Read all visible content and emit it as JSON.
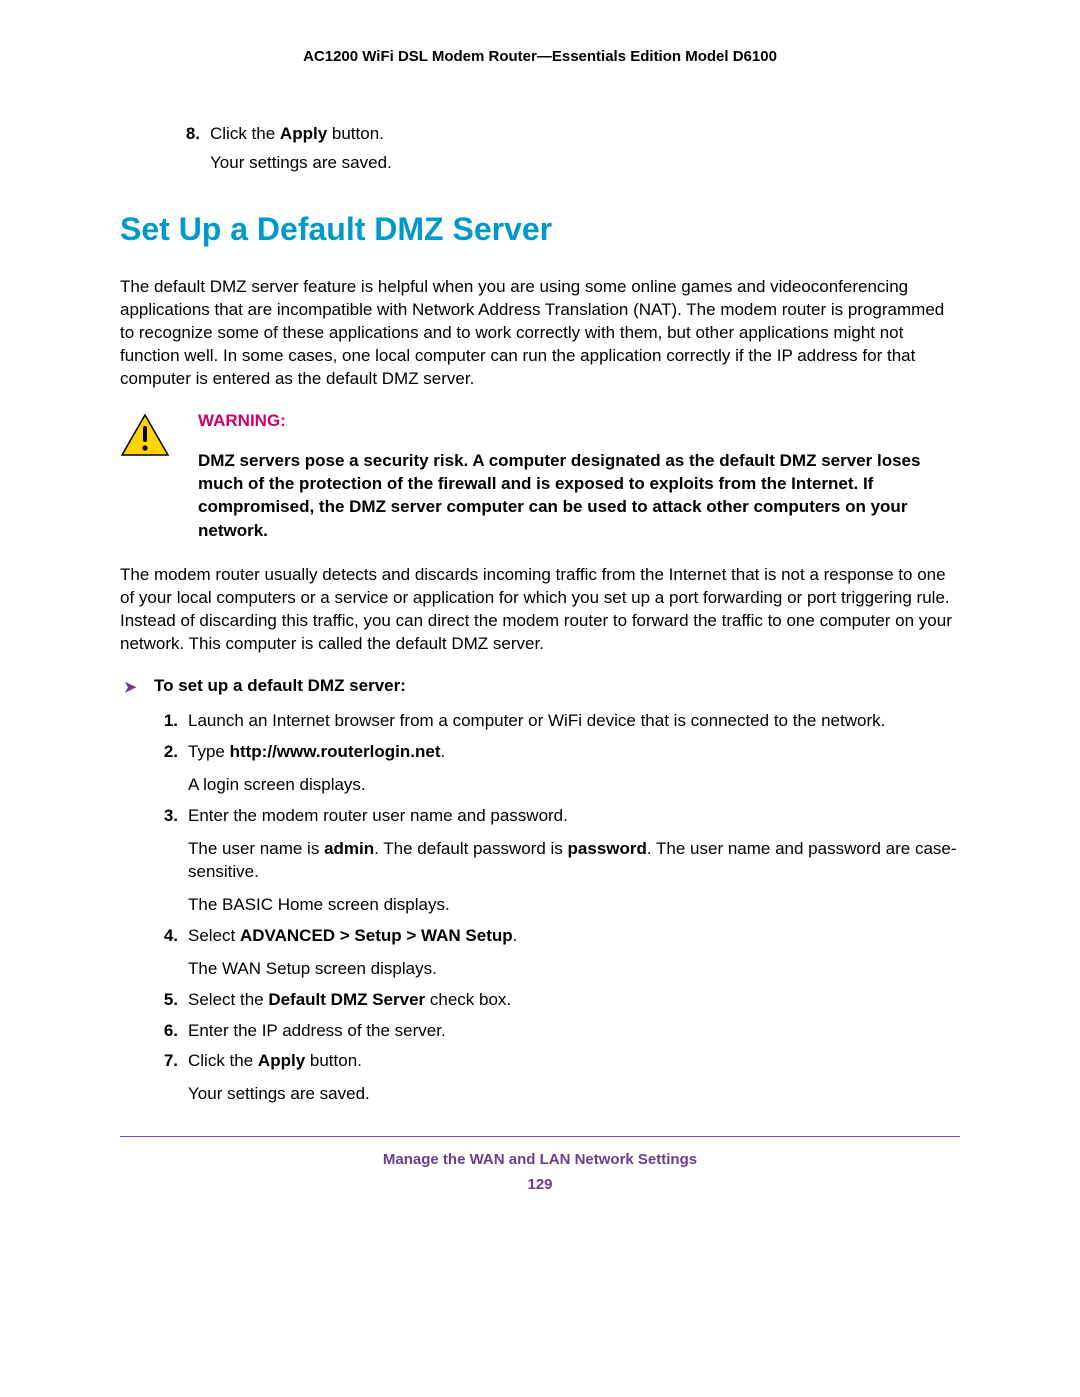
{
  "header": {
    "title": "AC1200 WiFi DSL Modem Router—Essentials Edition Model D6100"
  },
  "prior_steps": {
    "num8": "8.",
    "line8_pre": "Click the ",
    "line8_bold": "Apply",
    "line8_post": " button.",
    "line8_sub": "Your settings are saved."
  },
  "section_heading": "Set Up a Default DMZ Server",
  "para1": "The default DMZ server feature is helpful when you are using some online games and videoconferencing applications that are incompatible with Network Address Translation (NAT). The modem router is programmed to recognize some of these applications and to work correctly with them, but other applications might not function well. In some cases, one local computer can run the application correctly if the IP address for that computer is entered as the default DMZ server.",
  "warning": {
    "label": "WARNING:",
    "text": "DMZ servers pose a security risk. A computer designated as the default DMZ server loses much of the protection of the firewall and is exposed to exploits from the Internet. If compromised, the DMZ server computer can be used to attack other computers on your network."
  },
  "para2": "The modem router usually detects and discards incoming traffic from the Internet that is not a response to one of your local computers or a service or application for which you set up a port forwarding or port triggering rule. Instead of discarding this traffic, you can direct the modem router to forward the traffic to one computer on your network. This computer is called the default DMZ server.",
  "procedure_intro": "To set up a default DMZ server:",
  "steps": {
    "n1": "1.",
    "s1": "Launch an Internet browser from a computer or WiFi device that is connected to the network.",
    "n2": "2.",
    "s2_pre": "Type ",
    "s2_bold": "http://www.routerlogin.net",
    "s2_post": ".",
    "s2_sub": "A login screen displays.",
    "n3": "3.",
    "s3": "Enter the modem router user name and password.",
    "s3_sub_a": "The user name is ",
    "s3_sub_b": "admin",
    "s3_sub_c": ". The default password is ",
    "s3_sub_d": "password",
    "s3_sub_e": ". The user name and password are case-sensitive.",
    "s3_sub2": "The BASIC Home screen displays.",
    "n4": "4.",
    "s4_pre": "Select ",
    "s4_bold": "ADVANCED > Setup > WAN Setup",
    "s4_post": ".",
    "s4_sub": "The WAN Setup screen displays.",
    "n5": "5.",
    "s5_pre": "Select the ",
    "s5_bold": "Default DMZ Server",
    "s5_post": " check box.",
    "n6": "6.",
    "s6": "Enter the IP address of the server.",
    "n7": "7.",
    "s7_pre": "Click the ",
    "s7_bold": "Apply",
    "s7_post": " button.",
    "s7_sub": "Your settings are saved."
  },
  "footer": {
    "title": "Manage the WAN and LAN Network Settings",
    "page": "129"
  }
}
